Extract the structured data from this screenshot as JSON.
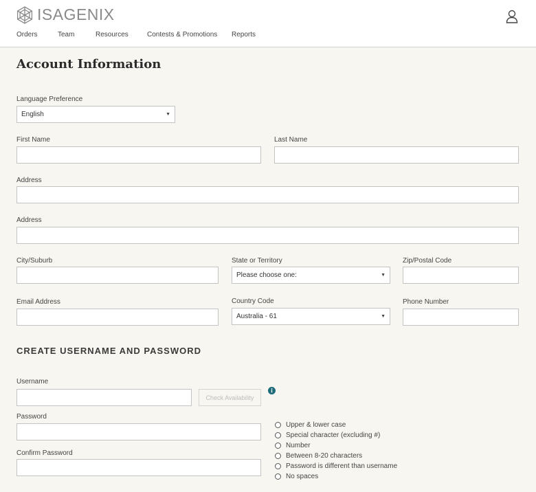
{
  "header": {
    "brand": "ISAGENIX",
    "nav": [
      "Orders",
      "Team",
      "Resources",
      "Contests & Promotions",
      "Reports"
    ]
  },
  "main": {
    "title": "Account Information",
    "language": {
      "label": "Language Preference",
      "value": "English"
    },
    "first_name": {
      "label": "First Name",
      "value": ""
    },
    "last_name": {
      "label": "Last Name",
      "value": ""
    },
    "address1": {
      "label": "Address",
      "value": ""
    },
    "address2": {
      "label": "Address",
      "value": ""
    },
    "city": {
      "label": "City/Suburb",
      "value": ""
    },
    "state": {
      "label": "State or Territory",
      "value": "Please choose one:"
    },
    "zip": {
      "label": "Zip/Postal Code",
      "value": ""
    },
    "email": {
      "label": "Email Address",
      "value": ""
    },
    "country_code": {
      "label": "Country Code",
      "value": "Australia - 61"
    },
    "phone": {
      "label": "Phone Number",
      "value": ""
    },
    "credentials": {
      "title": "CREATE USERNAME AND PASSWORD",
      "username": {
        "label": "Username",
        "value": ""
      },
      "check_label": "Check Availability",
      "password": {
        "label": "Password",
        "value": ""
      },
      "confirm": {
        "label": "Confirm Password",
        "value": ""
      },
      "rules": [
        "Upper & lower case",
        "Special character (excluding #)",
        "Number",
        "Between 8-20 characters",
        "Password is different than username",
        "No spaces"
      ]
    }
  },
  "colors": {
    "accent": "#1e6b7b",
    "background": "#f8f6f0",
    "border": "#c3c3c3"
  },
  "icons": [
    "isagenix-logo-icon",
    "user-icon",
    "chevron-down-icon",
    "info-icon",
    "radio-icon"
  ]
}
